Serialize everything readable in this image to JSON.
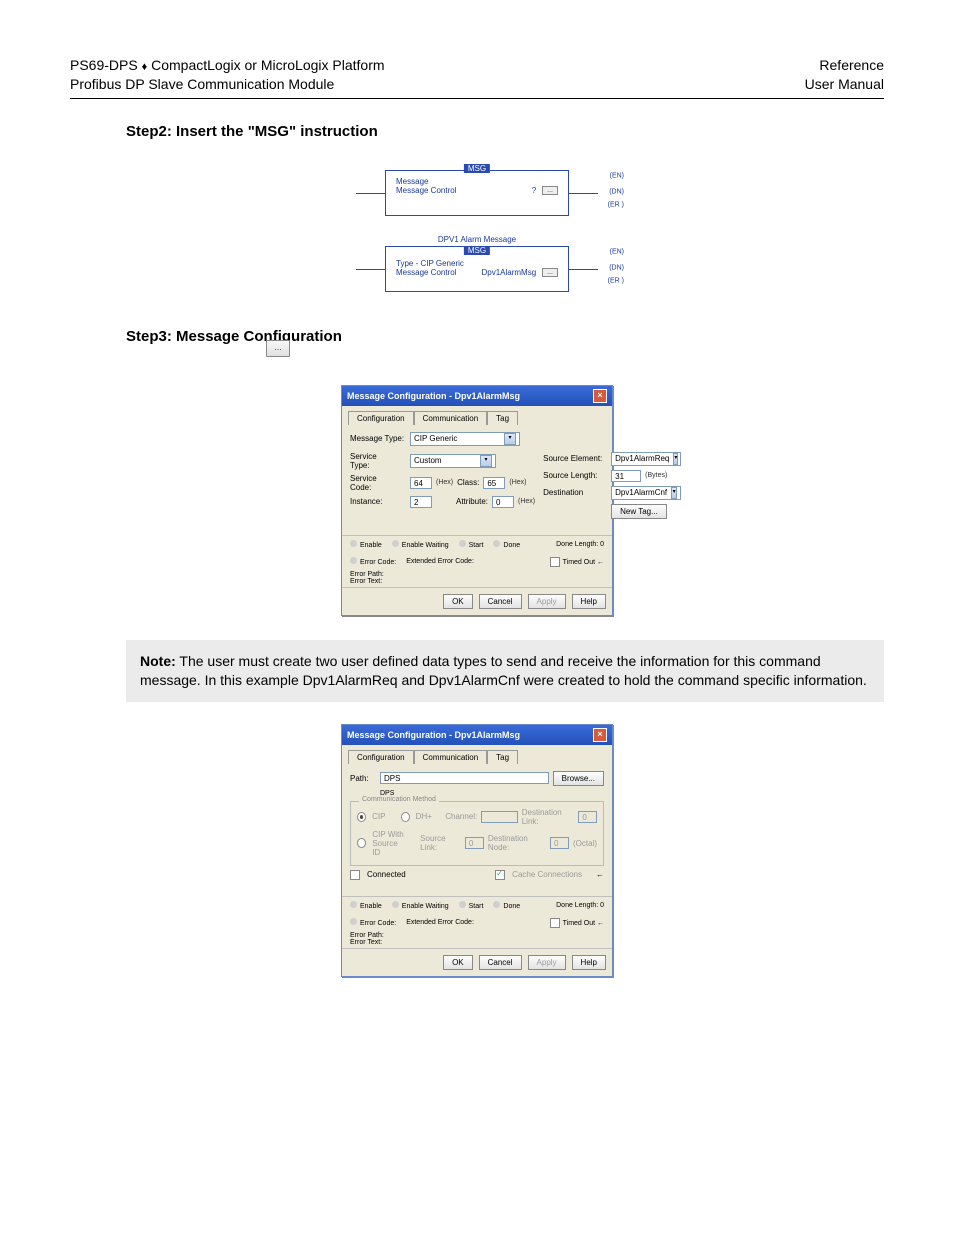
{
  "header": {
    "left1_a": "PS69-DPS ",
    "left1_b": "♦",
    "left1_c": " CompactLogix or MicroLogix Platform",
    "left2": "Profibus DP Slave Communication Module",
    "right1": "Reference",
    "right2": "User Manual"
  },
  "step2": {
    "heading": "Step2: Insert the \"MSG\" instruction"
  },
  "ladder1": {
    "flag": "MSG",
    "l1": "Message",
    "l2": "Message Control",
    "q": "?",
    "btn": "...",
    "en": "(EN)",
    "dn": "(DN)",
    "er": "(ER )"
  },
  "ladder2": {
    "title": "DPV1 Alarm Message",
    "flag": "MSG",
    "l1": "Type - CIP Generic",
    "l2": "Message Control",
    "tag": "Dpv1AlarmMsg",
    "btn": "...",
    "en": "(EN)",
    "dn": "(DN)",
    "er": "(ER )"
  },
  "step3": {
    "heading": "Step3: Message Configuration"
  },
  "ellipsis_icon": "...",
  "dlg1": {
    "title": "Message Configuration - Dpv1AlarmMsg",
    "tabs": [
      "Configuration",
      "Communication",
      "Tag"
    ],
    "msgtype_lbl": "Message Type:",
    "msgtype_val": "CIP Generic",
    "svctype_lbl": "Service\nType:",
    "svctype_val": "Custom",
    "svccode_lbl": "Service\nCode:",
    "svccode_val": "64",
    "hex": "(Hex)",
    "class_lbl": "Class:",
    "class_val": "65",
    "instance_lbl": "Instance:",
    "instance_val": "2",
    "attr_lbl": "Attribute:",
    "attr_val": "0",
    "src_lbl": "Source Element:",
    "src_val": "Dpv1AlarmReq",
    "srclen_lbl": "Source Length:",
    "srclen_val": "31",
    "bytes": "(Bytes)",
    "dest_lbl": "Destination",
    "dest_val": "Dpv1AlarmCnf",
    "newtag": "New Tag...",
    "status": {
      "enable": "Enable",
      "ew": "Enable Waiting",
      "start": "Start",
      "done": "Done",
      "donelen": "Done Length: 0",
      "errcode": "Error Code:",
      "ext": "Extended Error Code:",
      "errpath": "Error Path:",
      "errtext": "Error Text:",
      "timed": "Timed Out"
    },
    "buttons": {
      "ok": "OK",
      "cancel": "Cancel",
      "apply": "Apply",
      "help": "Help"
    }
  },
  "note": "Note: The user must create two user defined data types to send and receive the information for this command message. In this example Dpv1AlarmReq and Dpv1AlarmCnf were created to hold the command specific information.",
  "note_prefix": "Note:",
  "note_body": " The user must create two user defined data types to send and receive the information for this command message. In this example Dpv1AlarmReq and Dpv1AlarmCnf were created to hold the command specific information.",
  "dlg2": {
    "title": "Message Configuration - Dpv1AlarmMsg",
    "tabs": [
      "Configuration",
      "Communication",
      "Tag"
    ],
    "path_lbl": "Path:",
    "path_val": "DPS",
    "path_echo": "DPS",
    "browse": "Browse...",
    "group_legend": "Communication Method",
    "r_cip": "CIP",
    "r_dh": "DH+",
    "r_channel": "Channel:",
    "r_cipsrc": "CIP With\nSource ID",
    "r_srclink": "Source Link:",
    "destlink_lbl": "Destination Link:",
    "destnode_lbl": "Destination Node:",
    "octal": "(Octal)",
    "connected": "Connected",
    "cache": "Cache Connections",
    "status": {
      "enable": "Enable",
      "ew": "Enable Waiting",
      "start": "Start",
      "done": "Done",
      "donelen": "Done Length: 0",
      "errcode": "Error Code:",
      "ext": "Extended Error Code:",
      "errpath": "Error Path:",
      "errtext": "Error Text:",
      "timed": "Timed Out"
    },
    "buttons": {
      "ok": "OK",
      "cancel": "Cancel",
      "apply": "Apply",
      "help": "Help"
    },
    "zero": "0"
  }
}
